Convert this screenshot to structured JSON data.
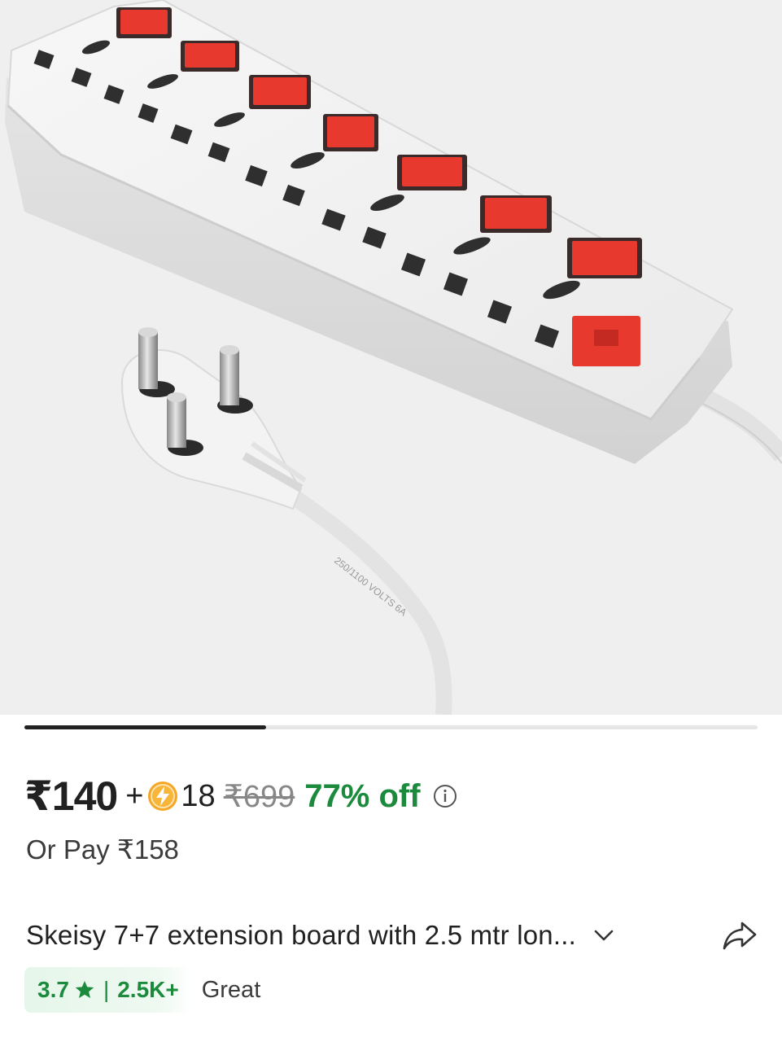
{
  "product": {
    "price": "₹140",
    "plus": "+",
    "coins": "18",
    "mrp": "₹699",
    "discount": "77% off",
    "or_pay": "Or Pay ₹158",
    "title": "Skeisy 7+7 extension board with 2.5 mtr lon...",
    "rating": "3.7",
    "separator": "|",
    "rating_count": "2.5K+",
    "rating_label": "Great"
  },
  "carousel": {
    "progress_fraction": 0.33
  },
  "icons": {
    "coin": "supercoin-icon",
    "info": "info-icon",
    "chevron": "chevron-down-icon",
    "share": "share-icon",
    "star": "star-icon"
  },
  "colors": {
    "price_text": "#212121",
    "mrp_text": "#878787",
    "discount": "#1b8a3c",
    "rating_badge_bg": "#e6f6ea",
    "coin": "#f5a623",
    "switch_red": "#e8392f",
    "image_bg": "#efefef"
  }
}
